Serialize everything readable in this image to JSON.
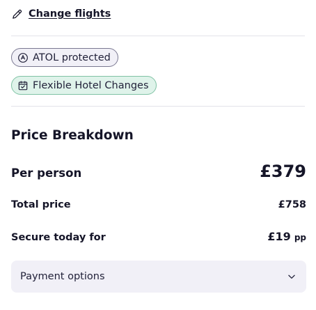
{
  "change_flights": {
    "label": "Change flights",
    "icon": "pencil-icon"
  },
  "badges": {
    "atol": {
      "label": "ATOL protected",
      "icon": "atol-icon"
    },
    "flexible": {
      "label": "Flexible Hotel Changes",
      "icon": "calendar-check-icon"
    }
  },
  "price_breakdown": {
    "title": "Price Breakdown",
    "per_person": {
      "label": "Per person",
      "value": "£379"
    },
    "total": {
      "label": "Total price",
      "value": "£758"
    },
    "secure": {
      "label": "Secure today for",
      "value": "£19",
      "suffix": "pp"
    }
  },
  "payment_options": {
    "label": "Payment options",
    "icon": "chevron-down-icon"
  },
  "colors": {
    "text": "#151528",
    "atol_bg": "#f1f0f7",
    "flexible_bg": "#dff3ea",
    "flexible_border": "#7fc2a4",
    "panel_bg": "#f1f0f7",
    "divider": "#e3e3ea"
  }
}
